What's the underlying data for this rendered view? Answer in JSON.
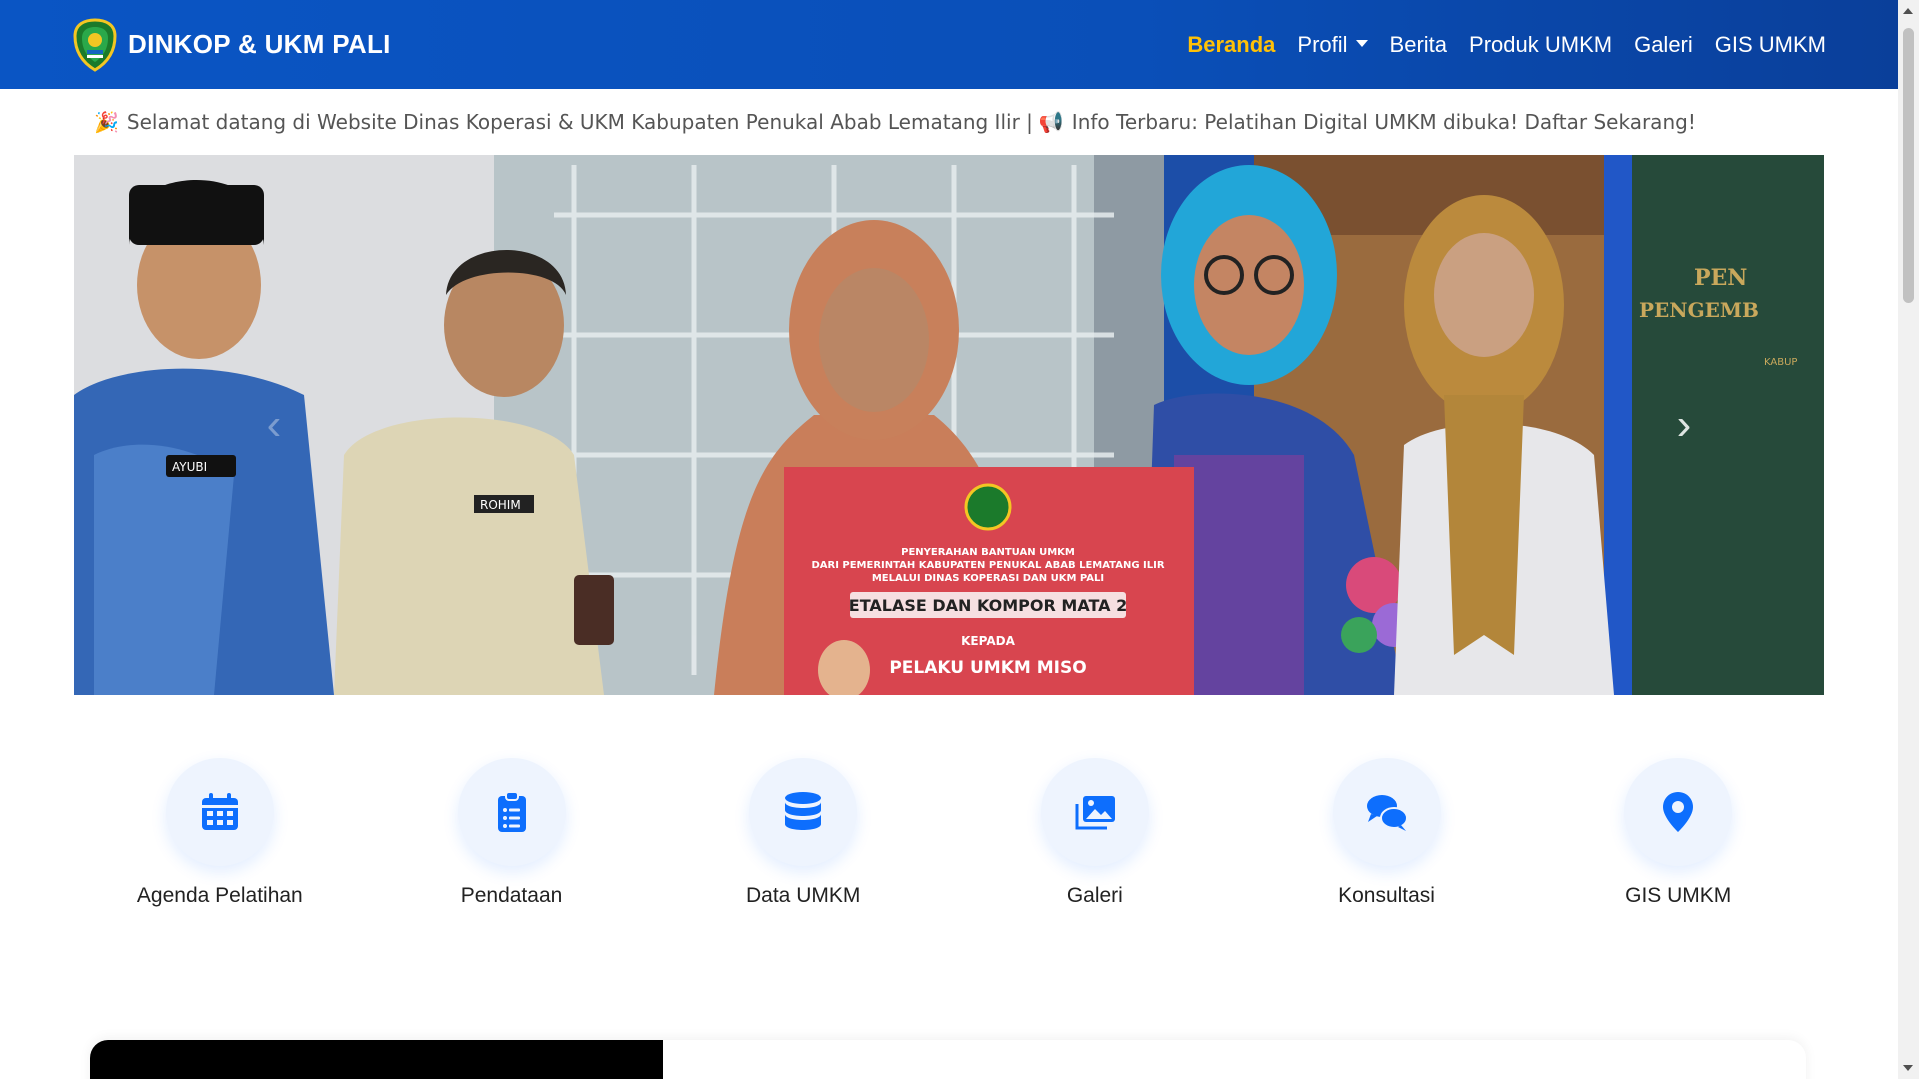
{
  "brand": {
    "name": "DINKOP & UKM PALI"
  },
  "nav": {
    "items": [
      {
        "label": "Beranda",
        "active": true
      },
      {
        "label": "Profil",
        "dropdown": true
      },
      {
        "label": "Berita"
      },
      {
        "label": "Produk UMKM"
      },
      {
        "label": "Galeri"
      },
      {
        "label": "GIS UMKM"
      }
    ]
  },
  "marquee": {
    "emoji1": "🎉",
    "text": "Selamat datang di Website Dinas Koperasi & UKM Kabupaten Penukal Abab Lematang Ilir | ",
    "emoji2": "📢",
    "text2": "Info Terbaru: Pelatihan Digital UMKM dibuka! Daftar Sekarang!"
  },
  "hero": {
    "banner": {
      "line1": "PENYERAHAN BANTUAN UMKM",
      "line2": "DARI PEMERINTAH KABUPATEN PENUKAL ABAB LEMATANG ILIR",
      "line3": "MELALUI DINAS KOPERASI DAN UKM PALI",
      "line4": "ETALASE DAN KOMPOR MATA 2",
      "line5": "KEPADA",
      "line6": "PELAKU UMKM MISO"
    },
    "badge_name": "AYUBI",
    "badge_name2": "ROHIM",
    "backdrop_text": "PEN",
    "backdrop_text2": "PENGEMB",
    "backdrop_text3": "KABUP",
    "prev": "‹",
    "next": "›"
  },
  "quick_links": [
    {
      "label": "Agenda Pelatihan",
      "icon": "calendar-icon"
    },
    {
      "label": "Pendataan",
      "icon": "clipboard-list-icon"
    },
    {
      "label": "Data UMKM",
      "icon": "database-icon"
    },
    {
      "label": "Galeri",
      "icon": "images-icon"
    },
    {
      "label": "Konsultasi",
      "icon": "comments-icon"
    },
    {
      "label": "GIS UMKM",
      "icon": "map-marker-icon"
    }
  ],
  "colors": {
    "accent": "#0d6efd",
    "nav_active": "#ffc107",
    "nav_bg": "#0a50bd"
  }
}
